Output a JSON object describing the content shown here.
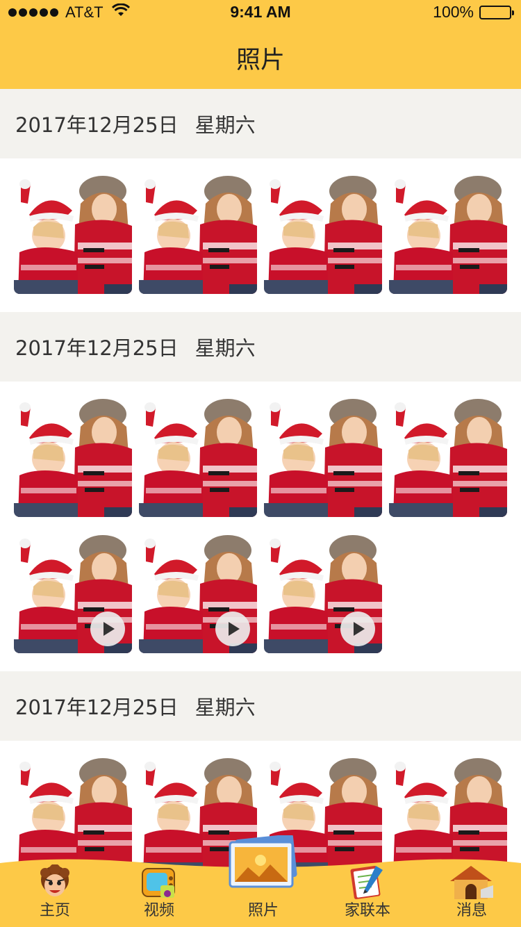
{
  "status": {
    "carrier": "AT&T",
    "time": "9:41 AM",
    "battery": "100%"
  },
  "nav": {
    "title": "照片"
  },
  "sections": [
    {
      "date": "2017年12月25日",
      "weekday": "星期六",
      "photos": [
        false,
        false,
        false,
        false
      ]
    },
    {
      "date": "2017年12月25日",
      "weekday": "星期六",
      "photos": [
        false,
        false,
        false,
        false,
        true,
        true,
        true
      ]
    },
    {
      "date": "2017年12月25日",
      "weekday": "星期六",
      "photos": [
        false,
        false,
        false,
        false
      ]
    }
  ],
  "tabs": [
    {
      "label": "主页",
      "icon": "boy-face-icon"
    },
    {
      "label": "视频",
      "icon": "tv-icon"
    },
    {
      "label": "照片",
      "icon": "photo-icon",
      "active": true
    },
    {
      "label": "家联本",
      "icon": "notebook-pencil-icon"
    },
    {
      "label": "消息",
      "icon": "doghouse-icon"
    }
  ],
  "colors": {
    "accent": "#fdc947",
    "section_bg": "#f3f2ee"
  }
}
